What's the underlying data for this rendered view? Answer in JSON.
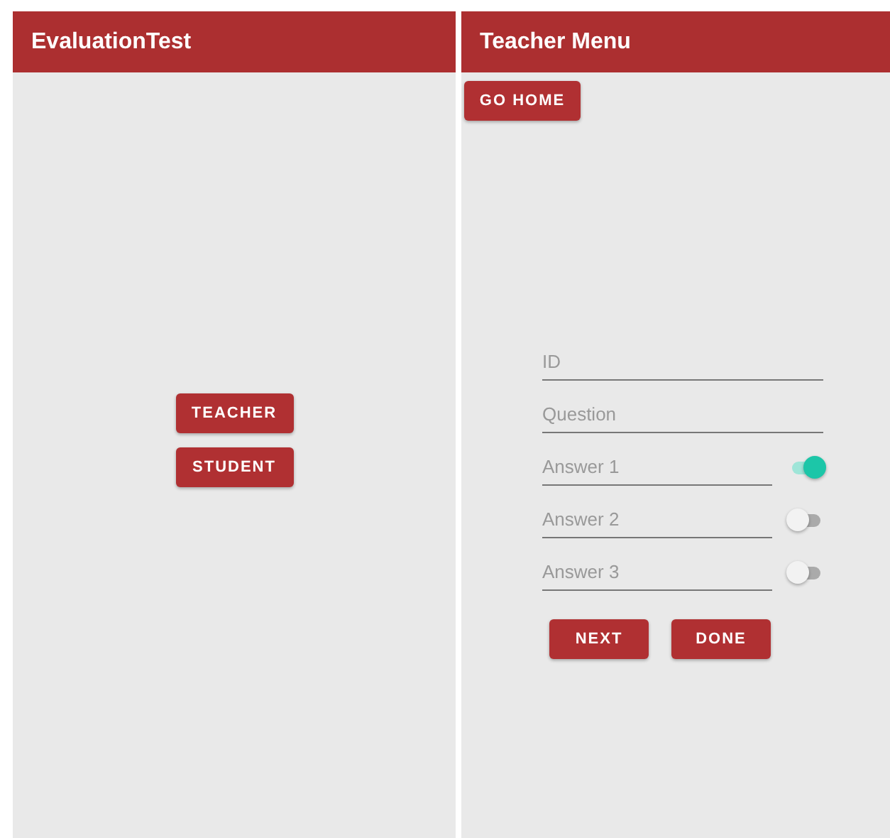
{
  "screens": [
    {
      "title": "EvaluationTest",
      "buttons": [
        "TEACHER",
        "STUDENT"
      ]
    },
    {
      "title": "Teacher Menu",
      "home_button": "GO HOME",
      "fields": [
        {
          "placeholder": "ID"
        },
        {
          "placeholder": "Question"
        }
      ],
      "answers": [
        {
          "placeholder": "Answer 1",
          "on": true
        },
        {
          "placeholder": "Answer 2",
          "on": false
        },
        {
          "placeholder": "Answer 3",
          "on": false
        }
      ],
      "buttons": [
        "NEXT",
        "DONE"
      ]
    }
  ]
}
